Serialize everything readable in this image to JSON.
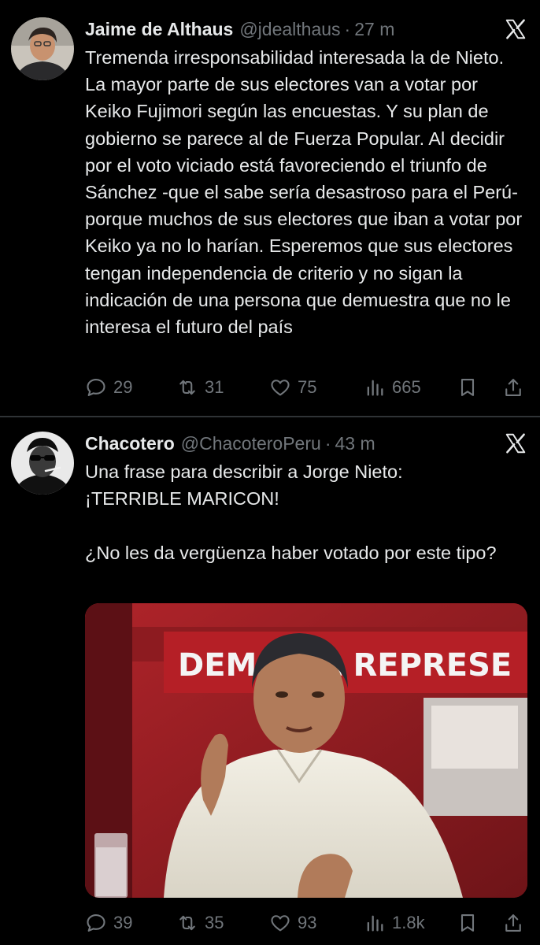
{
  "tweets": [
    {
      "author": {
        "name": "Jaime de Althaus",
        "handle": "@jdealthaus"
      },
      "separator": "·",
      "time": "27 m",
      "text": "Tremenda irresponsabilidad interesada la de Nieto. La mayor parte de sus electores van a votar por Keiko Fujimori según las encuestas. Y su plan de gobierno se parece al de Fuerza Popular. Al decidir por el voto viciado está favoreciendo el triunfo de Sánchez -que el sabe sería desastroso para el Perú-porque muchos de sus electores que iban a votar por Keiko ya no lo harían. Esperemos que sus electores tengan independencia de criterio y no sigan la indicación de una persona que demuestra que no le interesa el futuro del país",
      "stats": {
        "replies": "29",
        "reposts": "31",
        "likes": "75",
        "views": "665"
      }
    },
    {
      "author": {
        "name": "Chacotero",
        "handle": "@ChacoteroPeru"
      },
      "separator": "·",
      "time": "43 m",
      "text": "Una frase para describir a Jorge Nieto:\n¡TERRIBLE MARICON!\n\n¿No les da vergüenza haber votado por este tipo?",
      "media": {
        "banner_text": "DEMOC    A REPRESE"
      },
      "stats": {
        "replies": "39",
        "reposts": "35",
        "likes": "93",
        "views": "1.8k"
      }
    }
  ],
  "colors": {
    "background": "#000000",
    "text": "#e7e9ea",
    "muted": "#71767b",
    "divider": "#2f3336"
  },
  "icons": [
    "reply-icon",
    "repost-icon",
    "like-icon",
    "views-icon",
    "bookmark-icon",
    "share-icon",
    "x-logo-icon"
  ]
}
